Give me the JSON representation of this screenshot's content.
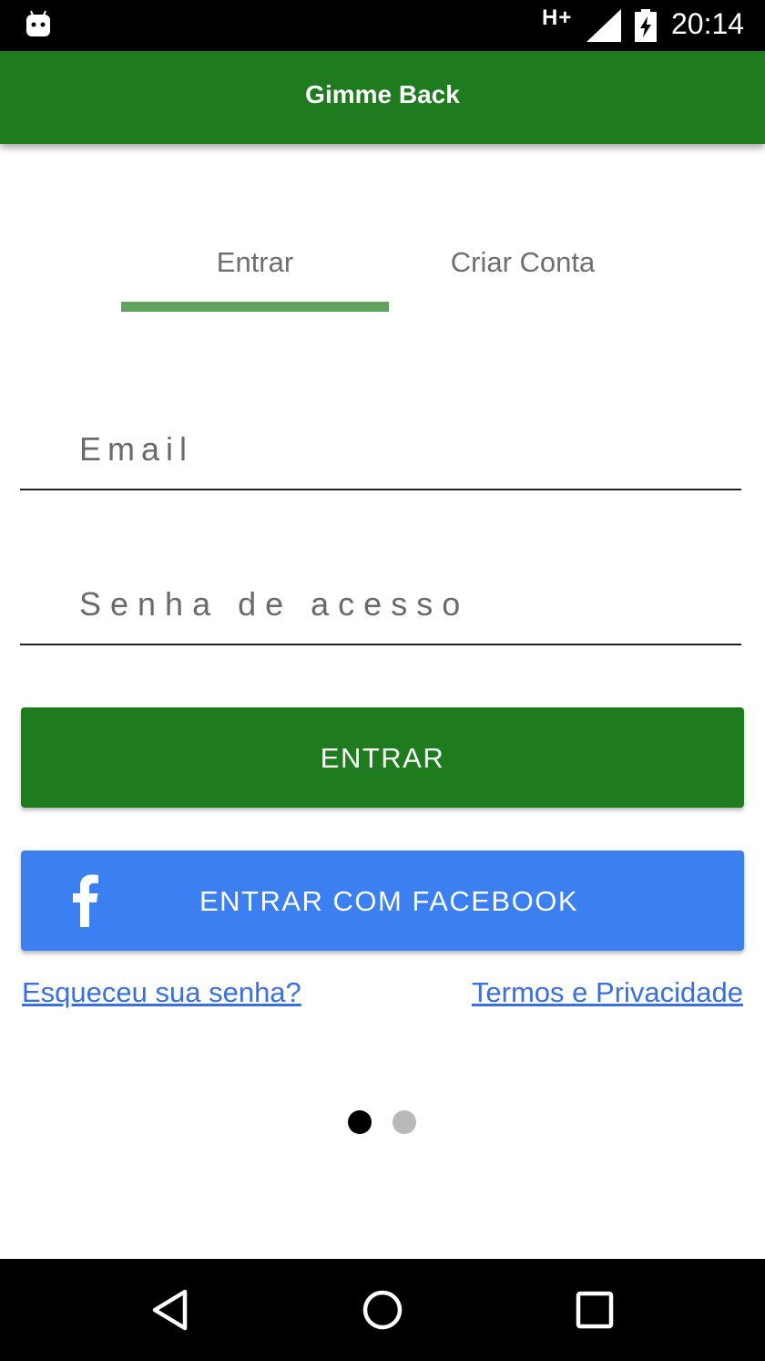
{
  "status_bar": {
    "network": "H+",
    "time": "20:14"
  },
  "app_bar": {
    "title": "Gimme Back"
  },
  "tabs": [
    {
      "label": "Entrar",
      "selected": true
    },
    {
      "label": "Criar Conta",
      "selected": false
    }
  ],
  "form": {
    "email_placeholder": "Email",
    "password_placeholder": "Senha de acesso",
    "submit_label": "ENTRAR",
    "facebook_label": "ENTRAR COM FACEBOOK",
    "facebook_icon": "f"
  },
  "links": {
    "forgot_password": "Esqueceu sua senha?",
    "terms": "Termos e Privacidade"
  },
  "pager": {
    "pages": 2,
    "current": 1
  },
  "icons": {
    "status_left": "android-icon",
    "signal": "signal-icon",
    "battery": "battery-charging-icon",
    "nav_back": "back-icon",
    "nav_home": "home-icon",
    "nav_recent": "recent-apps-icon"
  },
  "colors": {
    "primary": "#1e7b1e",
    "tab_indicator": "#5fa35f",
    "facebook": "#3b7ff0",
    "link": "#3a6fe0"
  }
}
